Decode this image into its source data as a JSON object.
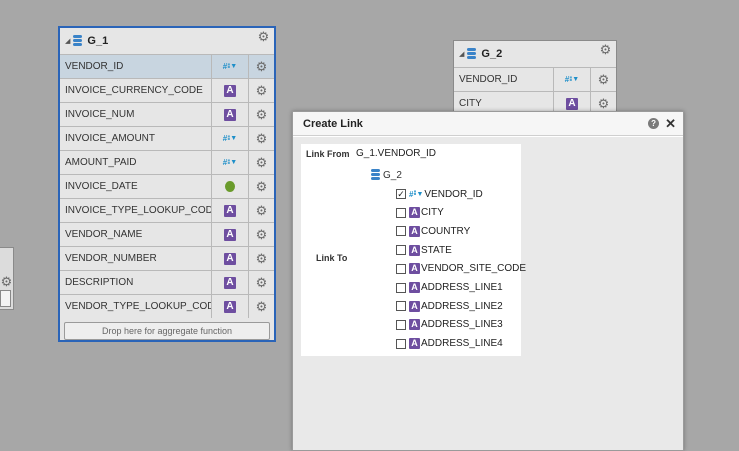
{
  "groups": {
    "g1": {
      "title": "G_1",
      "rows": [
        {
          "name": "VENDOR_ID",
          "type": "number"
        },
        {
          "name": "INVOICE_CURRENCY_CODE",
          "type": "string"
        },
        {
          "name": "INVOICE_NUM",
          "type": "string"
        },
        {
          "name": "INVOICE_AMOUNT",
          "type": "number"
        },
        {
          "name": "AMOUNT_PAID",
          "type": "number"
        },
        {
          "name": "INVOICE_DATE",
          "type": "date"
        },
        {
          "name": "INVOICE_TYPE_LOOKUP_CODE",
          "type": "string"
        },
        {
          "name": "VENDOR_NAME",
          "type": "string"
        },
        {
          "name": "VENDOR_NUMBER",
          "type": "string"
        },
        {
          "name": "DESCRIPTION",
          "type": "string"
        },
        {
          "name": "VENDOR_TYPE_LOOKUP_CODE",
          "type": "string"
        }
      ],
      "drop_zone": "Drop here for aggregate function"
    },
    "g2": {
      "title": "G_2",
      "rows": [
        {
          "name": "VENDOR_ID",
          "type": "number"
        },
        {
          "name": "CITY",
          "type": "string"
        }
      ]
    }
  },
  "type_glyphs": {
    "string": "A",
    "number": "# "
  },
  "dialog": {
    "title": "Create Link",
    "help_glyph": "?",
    "close_glyph": "✕",
    "link_from_label": "Link From",
    "link_from_value": "G_1.VENDOR_ID",
    "link_to_label": "Link To",
    "tree_root": "G_2",
    "tree_items": [
      {
        "name": "VENDOR_ID",
        "type": "number",
        "checked": true
      },
      {
        "name": "CITY",
        "type": "string",
        "checked": false
      },
      {
        "name": "COUNTRY",
        "type": "string",
        "checked": false
      },
      {
        "name": "STATE",
        "type": "string",
        "checked": false
      },
      {
        "name": "VENDOR_SITE_CODE",
        "type": "string",
        "checked": false
      },
      {
        "name": "ADDRESS_LINE1",
        "type": "string",
        "checked": false
      },
      {
        "name": "ADDRESS_LINE2",
        "type": "string",
        "checked": false
      },
      {
        "name": "ADDRESS_LINE3",
        "type": "string",
        "checked": false
      },
      {
        "name": "ADDRESS_LINE4",
        "type": "string",
        "checked": false
      }
    ]
  },
  "colors": {
    "selection_border": "#2a64b8",
    "string_badge": "#6e4ea0",
    "number_badge": "#1e8fc9",
    "date_badge": "#6a9b2b"
  }
}
